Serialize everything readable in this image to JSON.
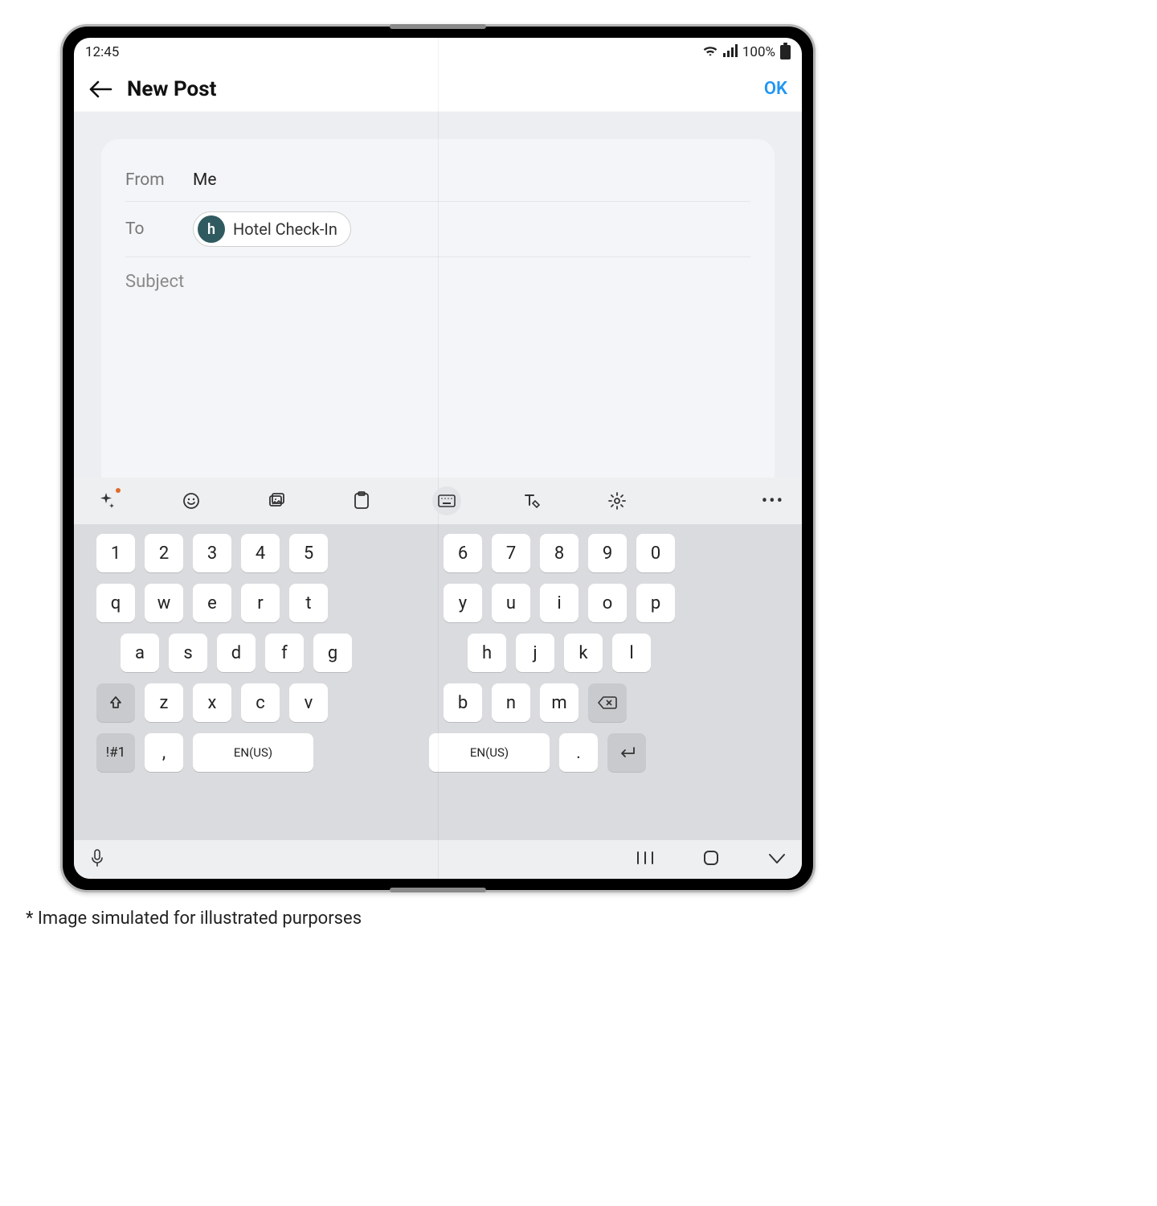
{
  "status": {
    "time": "12:45",
    "battery": "100%"
  },
  "header": {
    "title": "New Post",
    "ok": "OK"
  },
  "compose": {
    "from_label": "From",
    "from_value": "Me",
    "to_label": "To",
    "chip_initial": "h",
    "chip_name": "Hotel Check-In",
    "subject_placeholder": "Subject"
  },
  "keyboard": {
    "rows": {
      "numL": [
        "1",
        "2",
        "3",
        "4",
        "5"
      ],
      "numR": [
        "6",
        "7",
        "8",
        "9",
        "0"
      ],
      "r1L": [
        "q",
        "w",
        "e",
        "r",
        "t"
      ],
      "r1R": [
        "y",
        "u",
        "i",
        "o",
        "p"
      ],
      "r2L": [
        "a",
        "s",
        "d",
        "f",
        "g"
      ],
      "r2R": [
        "h",
        "j",
        "k",
        "l"
      ],
      "r3L": [
        "z",
        "x",
        "c",
        "v"
      ],
      "r3R": [
        "b",
        "n",
        "m"
      ]
    },
    "sym": "!#1",
    "comma": ",",
    "space": "EN(US)",
    "period": "."
  },
  "caption": "* Image simulated for illustrated purporses"
}
